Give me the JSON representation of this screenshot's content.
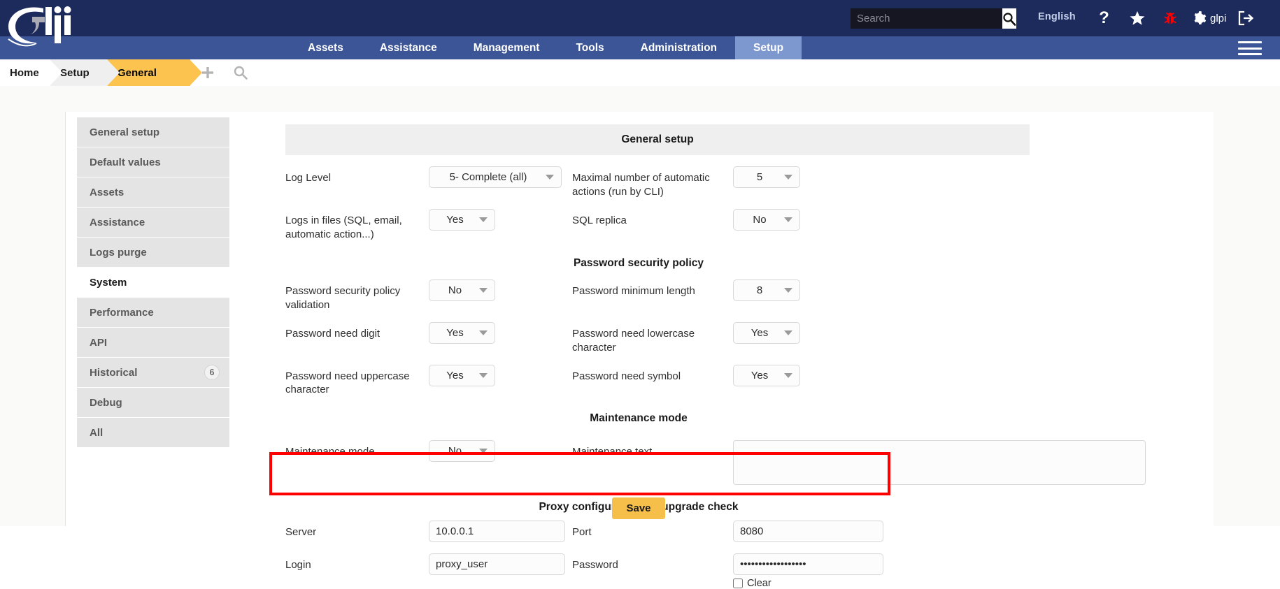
{
  "header": {
    "logo_text": "glpi",
    "search": {
      "placeholder": "Search",
      "value": ""
    },
    "search_icon": "search-icon",
    "language": "English",
    "icons": [
      {
        "name": "help-icon",
        "glyph": "?"
      },
      {
        "name": "favorite-star-icon",
        "glyph": "★"
      },
      {
        "name": "bug-report-icon",
        "glyph": "bug",
        "color": "#ff0000"
      },
      {
        "name": "settings-gear-icon",
        "glyph": "gear"
      }
    ],
    "username": "glpi",
    "logout_icon": "logout-icon"
  },
  "nav": {
    "items": [
      {
        "label": "Assets",
        "active": false
      },
      {
        "label": "Assistance",
        "active": false
      },
      {
        "label": "Management",
        "active": false
      },
      {
        "label": "Tools",
        "active": false
      },
      {
        "label": "Administration",
        "active": false
      },
      {
        "label": "Setup",
        "active": true
      }
    ],
    "menu_icon": "hamburger-menu-icon"
  },
  "breadcrumb": {
    "items": [
      "Home",
      "Setup",
      "General"
    ],
    "add_icon": "plus-icon",
    "search_icon": "magnifier-icon"
  },
  "sidebar": {
    "items": [
      {
        "label": "General setup",
        "active": false,
        "badge": ""
      },
      {
        "label": "Default values",
        "active": false,
        "badge": ""
      },
      {
        "label": "Assets",
        "active": false,
        "badge": ""
      },
      {
        "label": "Assistance",
        "active": false,
        "badge": ""
      },
      {
        "label": "Logs purge",
        "active": false,
        "badge": ""
      },
      {
        "label": "System",
        "active": true,
        "badge": ""
      },
      {
        "label": "Performance",
        "active": false,
        "badge": ""
      },
      {
        "label": "API",
        "active": false,
        "badge": ""
      },
      {
        "label": "Historical",
        "active": false,
        "badge": "6"
      },
      {
        "label": "Debug",
        "active": false,
        "badge": ""
      },
      {
        "label": "All",
        "active": false,
        "badge": ""
      }
    ]
  },
  "form": {
    "title": "General setup",
    "log_level_label": "Log Level",
    "log_level_value": "5- Complete (all)",
    "max_auto_label": "Maximal number of automatic actions (run by CLI)",
    "max_auto_value": "5",
    "logs_files_label": "Logs in files (SQL, email, automatic action...)",
    "logs_files_value": "Yes",
    "sql_replica_label": "SQL replica",
    "sql_replica_value": "No",
    "section_password": "Password security policy",
    "pw_policy_label": "Password security policy validation",
    "pw_policy_value": "No",
    "pw_minlen_label": "Password minimum length",
    "pw_minlen_value": "8",
    "pw_digit_label": "Password need digit",
    "pw_digit_value": "Yes",
    "pw_lower_label": "Password need lowercase character",
    "pw_lower_value": "Yes",
    "pw_upper_label": "Password need uppercase character",
    "pw_upper_value": "Yes",
    "pw_symbol_label": "Password need symbol",
    "pw_symbol_value": "Yes",
    "section_maintenance": "Maintenance mode",
    "maint_mode_label": "Maintenance mode",
    "maint_mode_value": "No",
    "maint_text_label": "Maintenance text",
    "maint_text_value": "",
    "section_proxy": "Proxy configuration for upgrade check",
    "server_label": "Server",
    "server_value": "10.0.0.1",
    "port_label": "Port",
    "port_value": "8080",
    "login_label": "Login",
    "login_value": "proxy_user",
    "password_label": "Password",
    "password_value": "••••••••••••••••••",
    "clear_label": "Clear",
    "clear_checked": false,
    "save_label": "Save"
  },
  "colors": {
    "header_bg": "#1d2a5c",
    "nav_bg": "#3c5596",
    "nav_active": "#7d97cf",
    "crumb_active": "#fcc34f",
    "save_btn": "#f6bf4a",
    "highlight_box": "#ff0000"
  }
}
